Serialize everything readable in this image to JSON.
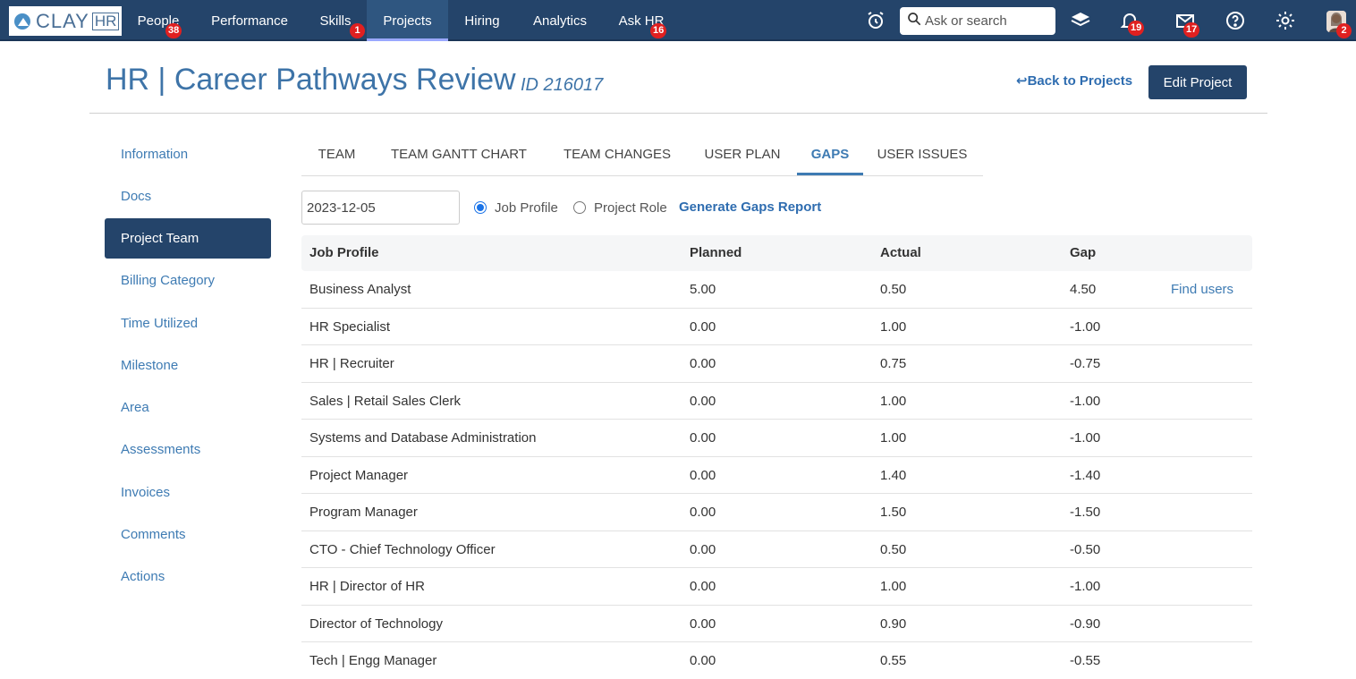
{
  "nav": {
    "logo_clay": "CLAY",
    "logo_hr": "HR",
    "items": [
      {
        "label": "People",
        "badge": "38"
      },
      {
        "label": "Performance",
        "badge": ""
      },
      {
        "label": "Skills",
        "badge": "1"
      },
      {
        "label": "Projects",
        "badge": ""
      },
      {
        "label": "Hiring",
        "badge": ""
      },
      {
        "label": "Analytics",
        "badge": ""
      },
      {
        "label": "Ask HR",
        "badge": "16"
      }
    ],
    "search_placeholder": "Ask or search",
    "notification_badge": "19",
    "mail_badge": "17",
    "avatar_badge": "2"
  },
  "header": {
    "title": "HR | Career Pathways Review",
    "id": "ID 216017",
    "back_link": "↩Back to Projects",
    "edit_button": "Edit Project"
  },
  "sidebar": {
    "items": [
      "Information",
      "Docs",
      "Project Team",
      "Billing Category",
      "Time Utilized",
      "Milestone",
      "Area",
      "Assessments",
      "Invoices",
      "Comments",
      "Actions"
    ],
    "active": "Project Team"
  },
  "tabs": {
    "items": [
      "TEAM",
      "TEAM GANTT CHART",
      "TEAM CHANGES",
      "USER PLAN",
      "GAPS",
      "USER ISSUES"
    ],
    "active": "GAPS"
  },
  "filters": {
    "date": "2023-12-05",
    "radio_job_profile": "Job Profile",
    "radio_project_role": "Project Role",
    "selected": "Job Profile",
    "generate_link": "Generate Gaps Report"
  },
  "table": {
    "columns": [
      "Job Profile",
      "Planned",
      "Actual",
      "Gap"
    ],
    "rows": [
      {
        "profile": "Business Analyst",
        "planned": "5.00",
        "actual": "0.50",
        "gap": "4.50",
        "action": "Find users"
      },
      {
        "profile": "HR Specialist",
        "planned": "0.00",
        "actual": "1.00",
        "gap": "-1.00",
        "action": ""
      },
      {
        "profile": "HR | Recruiter",
        "planned": "0.00",
        "actual": "0.75",
        "gap": "-0.75",
        "action": ""
      },
      {
        "profile": "Sales | Retail Sales Clerk",
        "planned": "0.00",
        "actual": "1.00",
        "gap": "-1.00",
        "action": ""
      },
      {
        "profile": "Systems and Database Administration",
        "planned": "0.00",
        "actual": "1.00",
        "gap": "-1.00",
        "action": ""
      },
      {
        "profile": "Project Manager",
        "planned": "0.00",
        "actual": "1.40",
        "gap": "-1.40",
        "action": ""
      },
      {
        "profile": "Program Manager",
        "planned": "0.00",
        "actual": "1.50",
        "gap": "-1.50",
        "action": ""
      },
      {
        "profile": "CTO - Chief Technology Officer",
        "planned": "0.00",
        "actual": "0.50",
        "gap": "-0.50",
        "action": ""
      },
      {
        "profile": "HR | Director of HR",
        "planned": "0.00",
        "actual": "1.00",
        "gap": "-1.00",
        "action": ""
      },
      {
        "profile": "Director of Technology",
        "planned": "0.00",
        "actual": "0.90",
        "gap": "-0.90",
        "action": ""
      },
      {
        "profile": "Tech | Engg Manager",
        "planned": "0.00",
        "actual": "0.55",
        "gap": "-0.55",
        "action": ""
      }
    ]
  },
  "icons": {
    "clock": "alarm-clock-icon",
    "search": "search-icon",
    "layers": "layers-icon",
    "bell": "bell-icon",
    "mail": "mail-icon",
    "help": "help-icon",
    "settings": "gear-icon"
  },
  "colors": {
    "navbar": "#24446a",
    "accent": "#3e7bb3",
    "badge": "#e02020"
  }
}
